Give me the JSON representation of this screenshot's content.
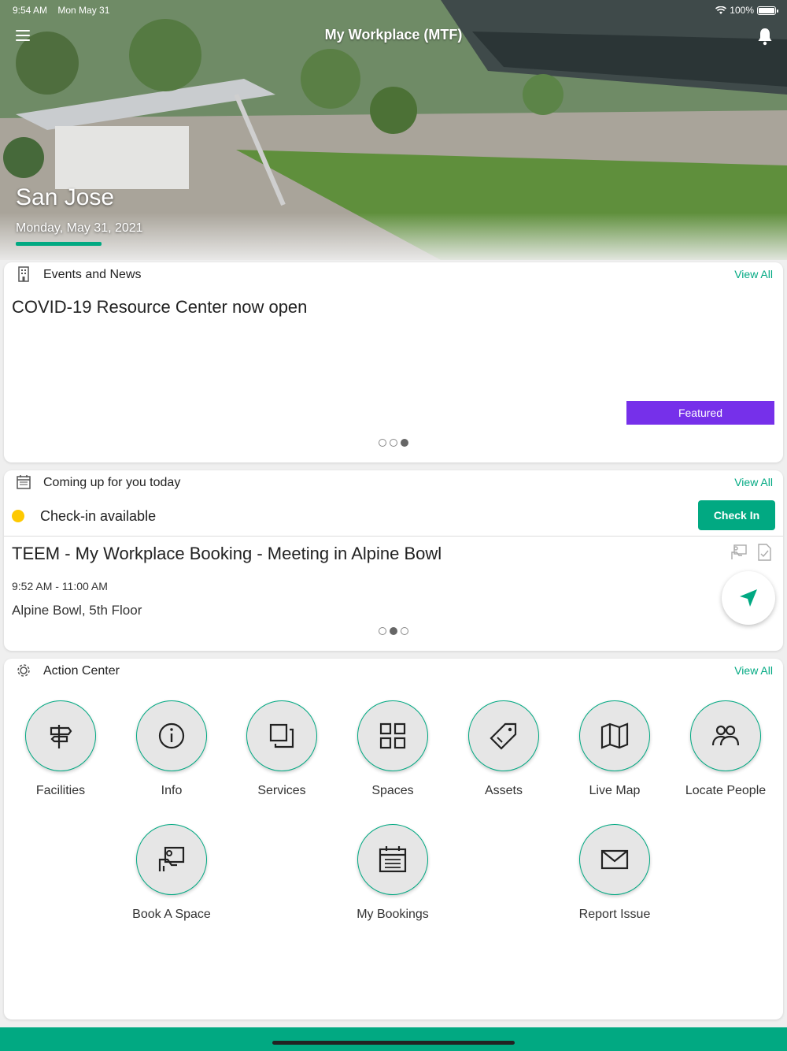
{
  "status_bar": {
    "time": "9:54 AM",
    "date": "Mon May 31",
    "battery": "100%",
    "battery_level": 1.0
  },
  "header": {
    "title": "My Workplace (MTF)",
    "menu_icon": "menu-icon",
    "notification_icon": "bell-icon"
  },
  "hero": {
    "location": "San Jose",
    "date": "Monday, May 31, 2021"
  },
  "events": {
    "title": "Events and News",
    "view_all": "View All",
    "headline": "COVID-19 Resource Center now open",
    "badge": "Featured",
    "page_count": 3,
    "active_page": 3
  },
  "today": {
    "title": "Coming up for you today",
    "view_all": "View All",
    "checkin_status": "Check-in available",
    "checkin_button": "Check In",
    "booking_title": "TEEM - My Workplace Booking - Meeting in Alpine Bowl",
    "booking_time": "9:52 AM - 11:00 AM",
    "booking_location": "Alpine Bowl, 5th Floor",
    "page_count": 3,
    "active_page": 2
  },
  "action_center": {
    "title": "Action Center",
    "view_all": "View All",
    "tiles": [
      {
        "label": "Facilities",
        "icon": "signpost-icon"
      },
      {
        "label": "Info",
        "icon": "info-icon"
      },
      {
        "label": "Services",
        "icon": "services-icon"
      },
      {
        "label": "Spaces",
        "icon": "grid-icon"
      },
      {
        "label": "Assets",
        "icon": "tag-icon"
      },
      {
        "label": "Live Map",
        "icon": "map-icon"
      },
      {
        "label": "Locate People",
        "icon": "people-icon"
      },
      {
        "label": "Book A Space",
        "icon": "book-space-icon"
      },
      {
        "label": "My Bookings",
        "icon": "calendar-icon"
      },
      {
        "label": "Report Issue",
        "icon": "mail-icon"
      }
    ]
  },
  "colors": {
    "accent": "#01a982",
    "featured": "#7630ea",
    "checkin_dot": "#fec901"
  }
}
